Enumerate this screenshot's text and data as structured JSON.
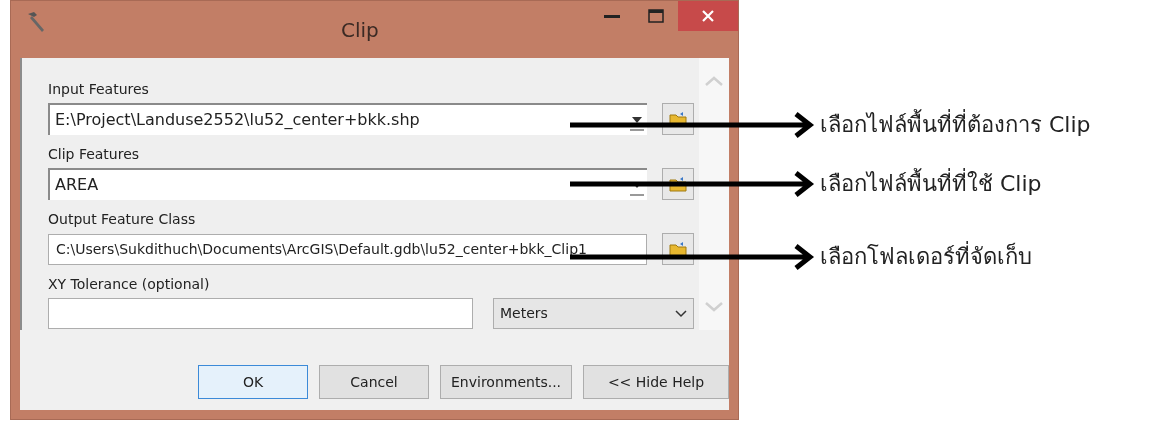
{
  "window": {
    "title": "Clip"
  },
  "fields": [
    {
      "label": "Input Features",
      "kind": "combo",
      "value": "E:\\Project\\Landuse2552\\lu52_center+bkk.shp"
    },
    {
      "label": "Clip Features",
      "kind": "combo",
      "value": "AREA"
    },
    {
      "label": "Output Feature Class",
      "kind": "path",
      "value": "C:\\Users\\Sukdithuch\\Documents\\ArcGIS\\Default.gdb\\lu52_center+bkk_Clip1"
    },
    {
      "label": "XY Tolerance (optional)",
      "kind": "measure",
      "unit": "Meters"
    }
  ],
  "buttons": [
    {
      "label": "OK",
      "default": true
    },
    {
      "label": "Cancel",
      "default": false
    },
    {
      "label": "Environments...",
      "default": false
    },
    {
      "label": "<< Hide Help",
      "default": false
    }
  ],
  "annotations": [
    "เลือกไฟล์พื้นที่ที่ต้องการ Clip",
    "เลือกไฟล์พื้นที่ที่ใช้ Clip",
    "เลือกโฟลเดอร์ที่จัดเก็บ"
  ]
}
